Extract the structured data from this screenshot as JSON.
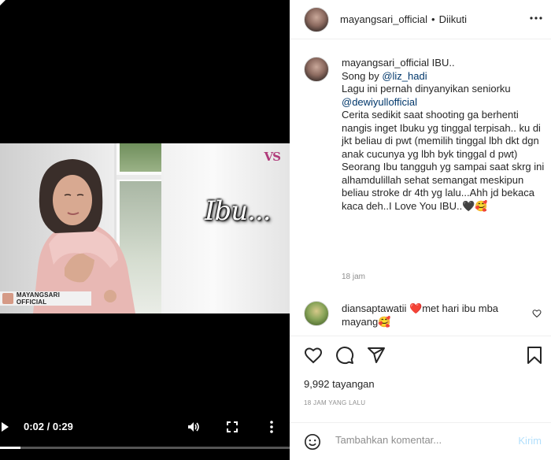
{
  "video": {
    "frame_logo": "VS",
    "frame_title": "Ibu...",
    "frame_badge": "MAYANGSARI OFFICIAL",
    "time": "0:02 / 0:29",
    "progress": 0.07
  },
  "header": {
    "username": "mayangsari_official",
    "dot": "•",
    "follow_status": "Diikuti"
  },
  "caption": {
    "username": "mayangsari_official",
    "lines": [
      {
        "text": "IBU.."
      },
      {
        "text": "Song by ",
        "mention": "@liz_hadi"
      },
      {
        "text": "Lagu ini pernah dinyanyikan seniorku"
      },
      {
        "mention": "@dewiyullofficial"
      },
      {
        "text": "Cerita sedikit saat shooting ga berhenti nangis inget Ibuku yg tinggal terpisah.. ku di jkt beliau di pwt (memilih tinggal lbh dkt dgn anak cucunya yg lbh byk tinggal d pwt)"
      },
      {
        "text": "Seorang Ibu tangguh yg sampai saat skrg ini alhamdulillah sehat semangat meskipun beliau stroke dr 4th yg lalu...Ahh jd bekaca kaca deh..I Love You IBU..🖤🥰"
      }
    ],
    "time": "18 jam"
  },
  "comment": {
    "username": "diansaptawatii",
    "text": "❤️met hari ibu mba mayang🥰"
  },
  "stats": {
    "views": "9,992 tayangan",
    "date": "18 JAM YANG LALU"
  },
  "comment_box": {
    "placeholder": "Tambahkan komentar...",
    "post_label": "Kirim"
  }
}
